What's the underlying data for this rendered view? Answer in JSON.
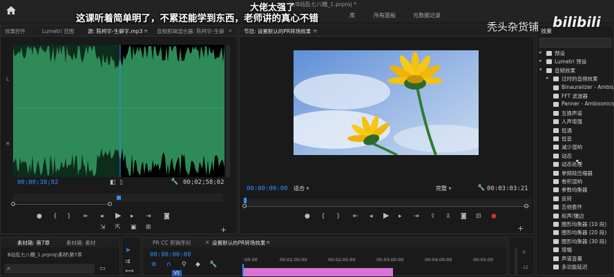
{
  "app": {
    "title_fragment": "站/B站乱七八糟_1.prproj *",
    "workspace_tabs": [
      "库",
      "所有面板",
      "元数据记录"
    ]
  },
  "overlay": {
    "caption_top": "大佬太强了",
    "caption_main": "这课听着简单明了，不累还能学到东西，老师讲的真心不错",
    "watermark": "秃头杂货铺",
    "logo_text": "bilibili"
  },
  "source_panel": {
    "tabs": [
      "效果控件",
      "Lumetri 范围",
      "源: 陈柯宇-生僻字.mp3",
      "音频剪辑混合器: 陈柯宇-生僻"
    ],
    "channel_labels": [
      "L",
      "R"
    ],
    "timecode_current": "00;00;38;02",
    "timecode_duration": "00;02;58;02"
  },
  "program_panel": {
    "title": "节目: 设置默认的PR转场效果",
    "timecode_current": "00:00:00:00",
    "fit_label": "适合",
    "quality_label": "完整",
    "timecode_duration": "00:03:03:21"
  },
  "effects_panel": {
    "title": "效果",
    "items": [
      {
        "label": "预设",
        "type": "folder",
        "level": 0,
        "expanded": false
      },
      {
        "label": "Lumetri 预设",
        "type": "folder",
        "level": 0,
        "expanded": false
      },
      {
        "label": "音频效果",
        "type": "folder",
        "level": 0,
        "expanded": true
      },
      {
        "label": "过时的音频效果",
        "type": "folder",
        "level": 1,
        "expanded": false
      },
      {
        "label": "Binauralizer - Ambisonics",
        "type": "effect",
        "level": 1
      },
      {
        "label": "FFT 滤波器",
        "type": "effect",
        "level": 1
      },
      {
        "label": "Panner - Ambisonics",
        "type": "effect",
        "level": 1
      },
      {
        "label": "互换声道",
        "type": "effect",
        "level": 1
      },
      {
        "label": "人声增强",
        "type": "effect",
        "level": 1
      },
      {
        "label": "低通",
        "type": "effect",
        "level": 1
      },
      {
        "label": "低音",
        "type": "effect",
        "level": 1
      },
      {
        "label": "减少混响",
        "type": "effect",
        "level": 1
      },
      {
        "label": "动态",
        "type": "effect",
        "level": 1
      },
      {
        "label": "动态处理",
        "type": "effect",
        "level": 1
      },
      {
        "label": "单频段压缩器",
        "type": "effect",
        "level": 1
      },
      {
        "label": "卷积混响",
        "type": "effect",
        "level": 1
      },
      {
        "label": "参数均衡器",
        "type": "effect",
        "level": 1
      },
      {
        "label": "反转",
        "type": "effect",
        "level": 1
      },
      {
        "label": "吉他套件",
        "type": "effect",
        "level": 1
      },
      {
        "label": "和声/镶边",
        "type": "effect",
        "level": 1
      },
      {
        "label": "图形均衡器 (10 段)",
        "type": "effect",
        "level": 1
      },
      {
        "label": "图形均衡器 (20 段)",
        "type": "effect",
        "level": 1
      },
      {
        "label": "图形均衡器 (30 段)",
        "type": "effect",
        "level": 1
      },
      {
        "label": "增幅",
        "type": "effect",
        "level": 1
      },
      {
        "label": "声道音量",
        "type": "effect",
        "level": 1
      },
      {
        "label": "多功能延迟",
        "type": "effect",
        "level": 1
      }
    ]
  },
  "project_panel": {
    "tabs": [
      "素材箱: 第7章",
      "素材箱: 素材"
    ],
    "path": "B站乱七八糟_1.prproj\\素材\\第7章"
  },
  "timeline_panel": {
    "tabs": [
      "PR CC 剪辑序列",
      "设置默认的PR转场效果"
    ],
    "timecode": "00:00:00:00",
    "ruler": [
      ":00:00",
      "00:01:00:00",
      "00:02:00:00",
      "00:03:00:00",
      "00:04:00:00",
      "00:05:00"
    ],
    "track_label": "V1"
  },
  "audio_meter": {
    "labels": [
      "0",
      "-12"
    ]
  },
  "colors": {
    "accent_blue": "#2f8fff",
    "waveform_green": "#2e8b57",
    "clip_pink": "#d872d8"
  }
}
